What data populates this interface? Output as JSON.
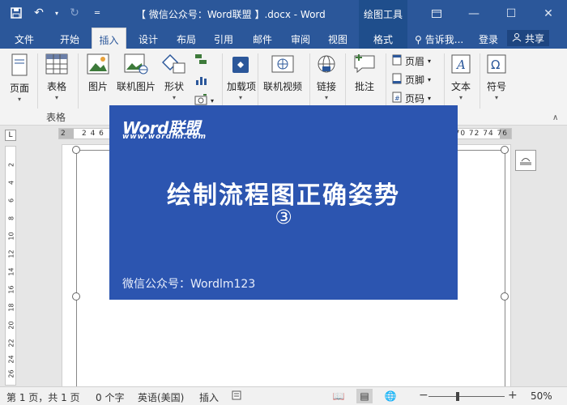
{
  "window": {
    "title": "【 微信公众号：Word联盟 】.docx - Word",
    "tools_tab": "绘图工具",
    "minimize_icon": "minimize-icon",
    "restore_icon": "restore-icon",
    "close_icon": "close-icon"
  },
  "qat": {
    "save_icon": "save-icon",
    "undo_icon": "undo-icon",
    "redo_icon": "redo-icon",
    "customize_icon": "customize-icon"
  },
  "tabs": [
    {
      "label": "文件"
    },
    {
      "label": "开始"
    },
    {
      "label": "插入"
    },
    {
      "label": "设计"
    },
    {
      "label": "布局"
    },
    {
      "label": "引用"
    },
    {
      "label": "邮件"
    },
    {
      "label": "审阅"
    },
    {
      "label": "视图"
    },
    {
      "label": "格式"
    }
  ],
  "header_right": {
    "tell_me": "告诉我...",
    "login": "登录",
    "share": "共享"
  },
  "ribbon": {
    "page": "页面",
    "table": "表格",
    "table_group": "表格",
    "picture": "图片",
    "online_picture": "联机图片",
    "shapes": "形状",
    "addins": "加载项",
    "online_video": "联机视频",
    "link": "链接",
    "comment": "批注",
    "header": "页眉",
    "footer": "页脚",
    "page_number": "页码",
    "text": "文本",
    "symbol": "符号"
  },
  "ruler": {
    "start": "2",
    "nums": "2  4  6",
    "end": "68 70 72 74 76",
    "vertical": [
      "2",
      "4",
      "6",
      "8",
      "10",
      "12",
      "14",
      "16",
      "18",
      "20",
      "22",
      "24",
      "26",
      "28"
    ]
  },
  "banner": {
    "brand": "Word联盟",
    "brand_url": "www.wordlm.com",
    "headline": "绘制流程图正确姿势",
    "sub": "③",
    "wechat": "微信公众号：Wordlm123"
  },
  "status": {
    "page": "第 1 页，共 1 页",
    "words": "0 个字",
    "language": "英语(美国)",
    "mode": "插入",
    "zoom_pct": "50%",
    "zoom_level": 0.5
  }
}
